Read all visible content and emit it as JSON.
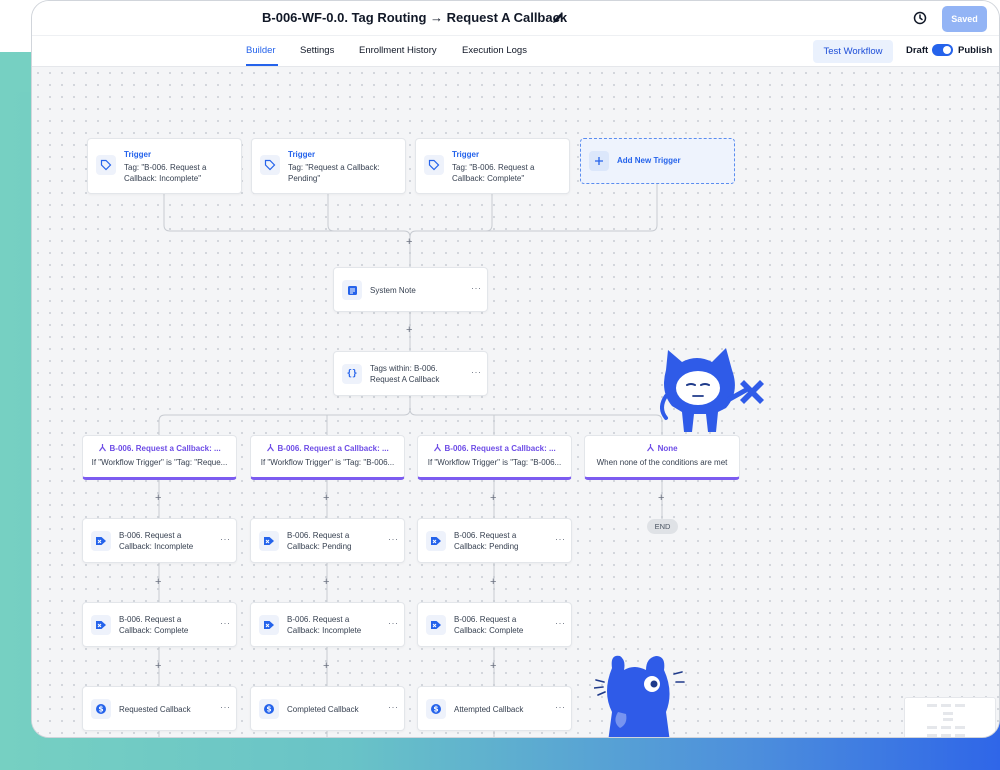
{
  "header": {
    "title": "B-006-WF-0.0. Tag Routing → Request A Callback",
    "saved_label": "Saved"
  },
  "tabs": [
    {
      "label": "Builder",
      "active": true
    },
    {
      "label": "Settings"
    },
    {
      "label": "Enrollment History"
    },
    {
      "label": "Execution Logs"
    }
  ],
  "toolbar": {
    "test_label": "Test Workflow",
    "draft_label": "Draft",
    "publish_label": "Publish",
    "publish_on": true
  },
  "triggers": [
    {
      "title": "Trigger",
      "line1": "Tag: \"B-006. Request a",
      "line2": "Callback: Incomplete\""
    },
    {
      "title": "Trigger",
      "line1": "Tag: \"Request a Callback:",
      "line2": "Pending\""
    },
    {
      "title": "Trigger",
      "line1": "Tag: \"B-006. Request a",
      "line2": "Callback: Complete\""
    }
  ],
  "add_trigger_label": "Add New Trigger",
  "system_note": {
    "label": "System Note"
  },
  "condition": {
    "line1": "Tags within: B-006.",
    "line2": "Request A Callback"
  },
  "branches": [
    {
      "title": "B-006. Request a Callback: ...",
      "text": "If \"Workflow Trigger\" is \"Tag: \"Reque..."
    },
    {
      "title": "B-006. Request a Callback: ...",
      "text": "If \"Workflow Trigger\" is \"Tag: \"B-006..."
    },
    {
      "title": "B-006. Request a Callback: ...",
      "text": "If \"Workflow Trigger\" is \"Tag: \"B-006..."
    },
    {
      "title": "None",
      "text": "When none of the conditions are met"
    }
  ],
  "row1": [
    {
      "line1": "B-006. Request a",
      "line2": "Callback: Incomplete"
    },
    {
      "line1": "B-006. Request a",
      "line2": "Callback: Pending"
    },
    {
      "line1": "B-006. Request a",
      "line2": "Callback: Pending"
    }
  ],
  "row2": [
    {
      "line1": "B-006. Request a",
      "line2": "Callback: Complete"
    },
    {
      "line1": "B-006. Request a",
      "line2": "Callback: Incomplete"
    },
    {
      "line1": "B-006. Request a",
      "line2": "Callback: Complete"
    }
  ],
  "row3": [
    {
      "label": "Requested Callback"
    },
    {
      "label": "Completed Callback"
    },
    {
      "label": "Attempted Callback"
    }
  ],
  "end_label": "END",
  "colors": {
    "accent": "#2563eb",
    "branch": "#7c5cf0",
    "mascot": "#2f5be8"
  }
}
